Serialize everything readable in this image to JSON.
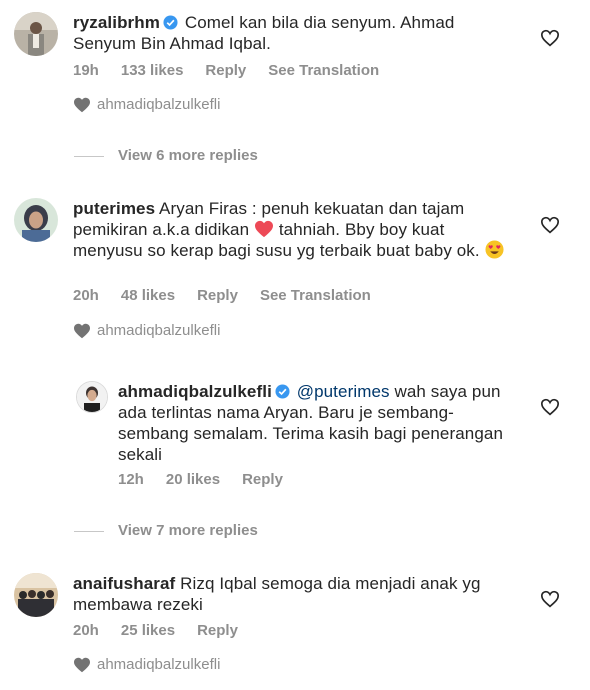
{
  "comments": [
    {
      "username": "ryzalibrhm",
      "verified": true,
      "text": "Comel kan bila dia senyum. Ahmad Senyum Bin Ahmad Iqbal.",
      "time": "19h",
      "likes": "133 likes",
      "reply": "Reply",
      "translate": "See Translation",
      "liked_by": "ahmadiqbalzulkefli",
      "view_more": "View 6 more replies"
    },
    {
      "username": "puterimes",
      "text_before": "Aryan Firas : penuh kekuatan dan tajam pemikiran a.k.a didikan",
      "text_after": "tahniah. Bby boy kuat menyusu so kerap bagi susu yg terbaik buat baby ok.",
      "time": "20h",
      "likes": "48 likes",
      "reply": "Reply",
      "translate": "See Translation",
      "liked_by": "ahmadiqbalzulkefli"
    },
    {
      "username": "ahmadiqbalzulkefli",
      "verified": true,
      "mention": "@puterimes",
      "text": "wah saya pun ada terlintas nama Aryan. Baru je sembang-sembang semalam. Terima kasih bagi penerangan sekali",
      "time": "12h",
      "likes": "20 likes",
      "reply": "Reply",
      "view_more": "View 7 more replies"
    },
    {
      "username": "anaifusharaf",
      "text": "Rizq Iqbal semoga dia menjadi anak yg membawa rezeki",
      "time": "20h",
      "likes": "25 likes",
      "reply": "Reply",
      "liked_by": "ahmadiqbalzulkefli"
    }
  ],
  "colors": {
    "meta": "#8e8e8e",
    "verified": "#3897f0",
    "red_heart": "#ed4956",
    "text": "#262626"
  },
  "icons": [
    "heart-outline-icon",
    "filled-heart-icon",
    "verified-badge-icon",
    "red-heart-emoji",
    "heart-eyes-emoji"
  ]
}
